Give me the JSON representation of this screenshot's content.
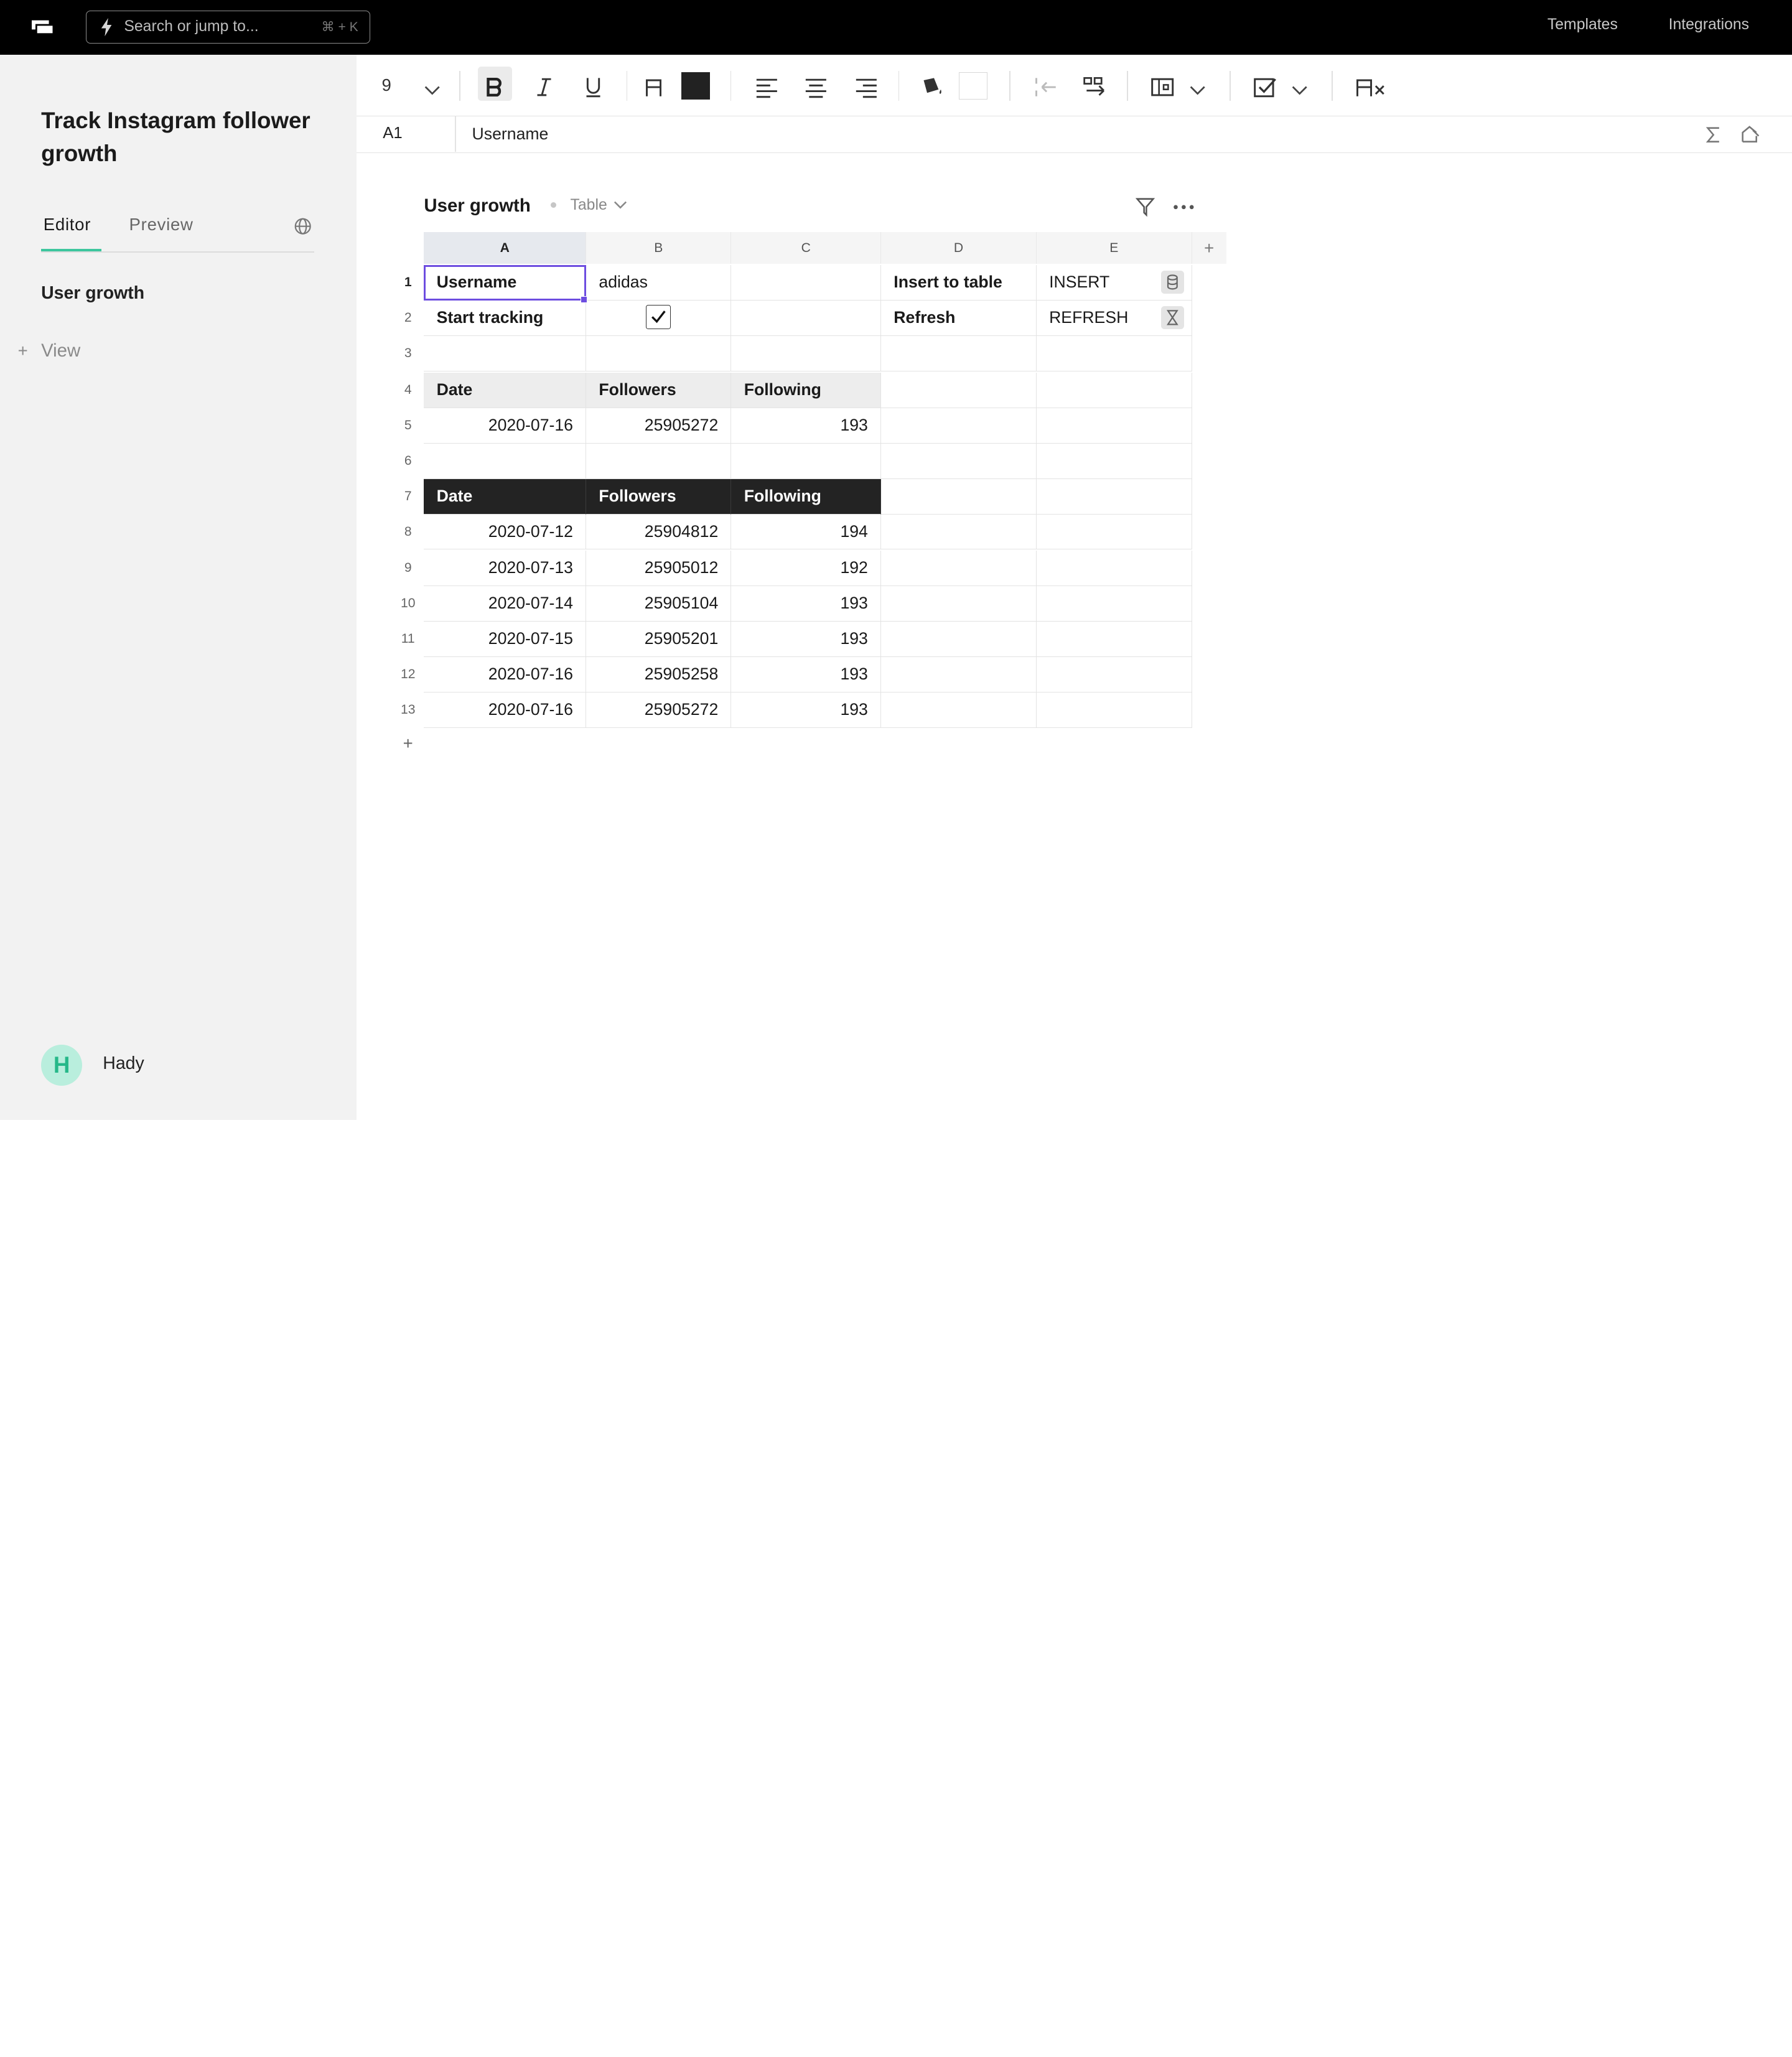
{
  "topbar": {
    "search_placeholder": "Search or jump to...",
    "search_shortcut": "⌘ + K",
    "links": [
      "Templates",
      "Integrations"
    ]
  },
  "sidebar": {
    "doc_title": "Track Instagram follower growth",
    "tabs": [
      "Editor",
      "Preview"
    ],
    "active_tab": "Editor",
    "items": [
      "User growth"
    ],
    "add_view_label": "View",
    "user": {
      "initial": "H",
      "name": "Hady",
      "avatar_color": "#b9eedd"
    }
  },
  "toolbar": {
    "font_size": "9",
    "text_color": "#222222",
    "fill_color": "#ffffff",
    "icons": [
      "bold-icon",
      "italic-icon",
      "underline-icon",
      "font-icon",
      "text-color-swatch",
      "align-left-icon",
      "align-center-icon",
      "align-right-icon",
      "fill-icon",
      "fill-color-swatch",
      "insert-left-icon",
      "insert-right-icon",
      "cell-type-icon",
      "checkbox-icon",
      "clear-format-icon"
    ]
  },
  "formula_bar": {
    "cell_ref": "A1",
    "value": "Username"
  },
  "sheet": {
    "title": "User growth",
    "view_type": "Table",
    "columns": [
      "A",
      "B",
      "C",
      "D",
      "E"
    ],
    "selected_column": "A",
    "selected_cell": "A1",
    "rows": [
      {
        "n": "1",
        "A": "Username",
        "B": "adidas",
        "C": "",
        "D": "Insert to table",
        "E": "INSERT"
      },
      {
        "n": "2",
        "A": "Start tracking",
        "B": "",
        "C": "",
        "D": "Refresh",
        "E": "REFRESH"
      },
      {
        "n": "3",
        "A": "",
        "B": "",
        "C": "",
        "D": "",
        "E": ""
      },
      {
        "n": "4",
        "A": "Date",
        "B": "Followers",
        "C": "Following",
        "D": "",
        "E": ""
      },
      {
        "n": "5",
        "A": "2020-07-16",
        "B": "25905272",
        "C": "193",
        "D": "",
        "E": ""
      },
      {
        "n": "6",
        "A": "",
        "B": "",
        "C": "",
        "D": "",
        "E": ""
      },
      {
        "n": "7",
        "A": "Date",
        "B": "Followers",
        "C": "Following",
        "D": "",
        "E": ""
      },
      {
        "n": "8",
        "A": "2020-07-12",
        "B": "25904812",
        "C": "194",
        "D": "",
        "E": ""
      },
      {
        "n": "9",
        "A": "2020-07-13",
        "B": "25905012",
        "C": "192",
        "D": "",
        "E": ""
      },
      {
        "n": "10",
        "A": "2020-07-14",
        "B": "25905104",
        "C": "193",
        "D": "",
        "E": ""
      },
      {
        "n": "11",
        "A": "2020-07-15",
        "B": "25905201",
        "C": "193",
        "D": "",
        "E": ""
      },
      {
        "n": "12",
        "A": "2020-07-16",
        "B": "25905258",
        "C": "193",
        "D": "",
        "E": ""
      },
      {
        "n": "13",
        "A": "2020-07-16",
        "B": "25905272",
        "C": "193",
        "D": "",
        "E": ""
      }
    ],
    "start_tracking_checked": true,
    "insert_icon": "database-icon",
    "refresh_icon": "hourglass-icon"
  }
}
